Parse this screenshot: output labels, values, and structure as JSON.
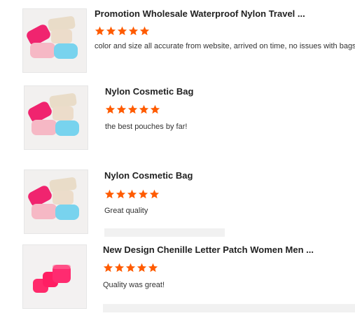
{
  "theme": {
    "star_color": "#ff5b00",
    "placeholder_color": "#f1f1f1"
  },
  "reviews": [
    {
      "title": "Promotion Wholesale Waterproof Nylon Travel ...",
      "rating": 5,
      "comment": "color and size all accurate from website, arrived on time, no issues with bags"
    },
    {
      "title": "Nylon Cosmetic Bag",
      "rating": 5,
      "comment": "the best pouches by far!"
    },
    {
      "title": "Nylon Cosmetic Bag",
      "rating": 5,
      "comment": "Great quality"
    },
    {
      "title": "New Design Chenille Letter Patch Women Men ...",
      "rating": 5,
      "comment": "Quality was great!"
    }
  ]
}
